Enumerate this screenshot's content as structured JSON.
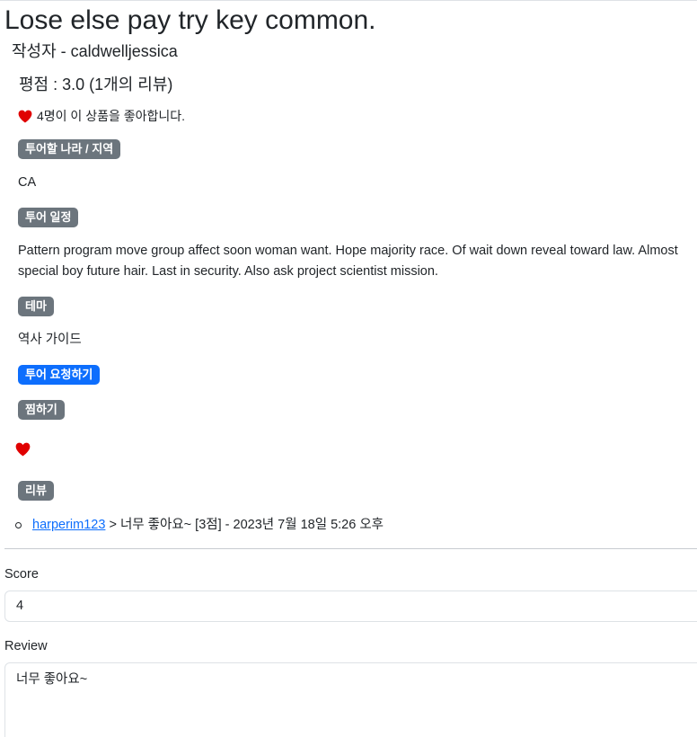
{
  "product": {
    "title": "Lose else pay try key common.",
    "author": "작성자 - caldwelljessica",
    "rating": "평점 : 3.0 (1개의 리뷰)",
    "likes": "4명이 이 상품을 좋아합니다."
  },
  "sections": {
    "country_label": "투어할 나라 / 지역",
    "country_value": "CA",
    "schedule_label": "투어 일정",
    "schedule_value": "Pattern program move group affect soon woman want. Hope majority race. Of wait down reveal toward law. Almost special boy future hair. Last in security. Also ask project scientist mission.",
    "theme_label": "테마",
    "theme_value": "역사 가이드",
    "request_button": "투어 요청하기",
    "favorite_label": "찜하기",
    "reviews_label": "리뷰"
  },
  "reviews": [
    {
      "user": "harperim123 ",
      "text": "> 너무 좋아요~ [3점] - 2023년 7월 18일 5:26 오후"
    }
  ],
  "form": {
    "score_label": "Score",
    "score_value": "4",
    "review_label": "Review",
    "review_value": "너무 좋아요~"
  },
  "colors": {
    "badge_secondary": "#6c757d",
    "badge_primary": "#0d6efd",
    "heart": "#e00000",
    "link": "#0d6efd"
  },
  "icons": {
    "likes_icon": "heart-icon",
    "favorite_icon": "heart-icon"
  }
}
